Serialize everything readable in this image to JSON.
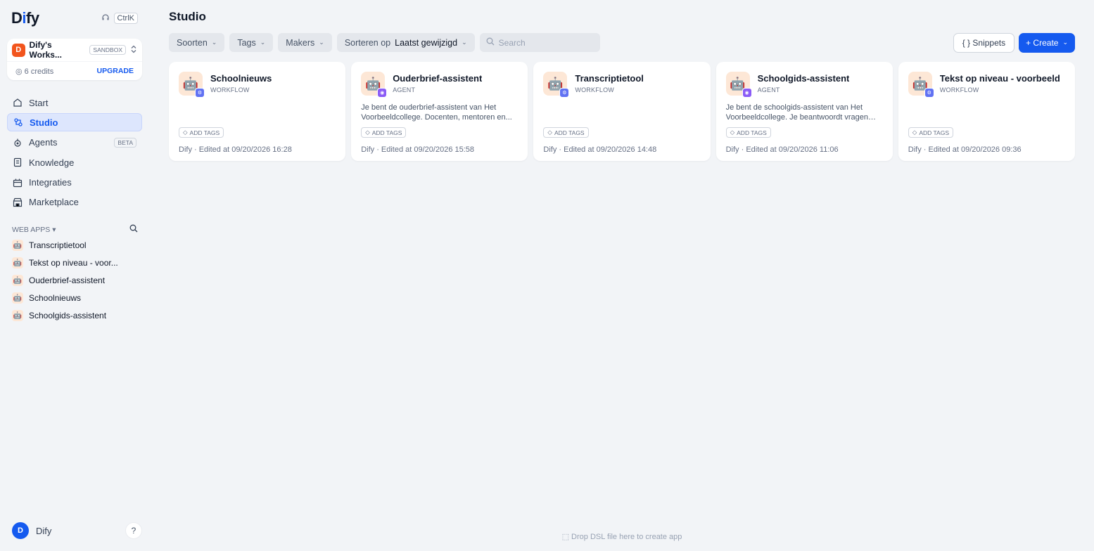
{
  "sidebar": {
    "logo_prefix": "D",
    "logo_i": "i",
    "logo_suffix": "fy",
    "shortcut": "CtrlK",
    "workspace": {
      "avatar": "D",
      "name": "Dify's Works...",
      "plan": "SANDBOX",
      "credits": "6 credits",
      "upgrade": "UPGRADE"
    },
    "nav": [
      {
        "label": "Start",
        "icon": "home-icon"
      },
      {
        "label": "Studio",
        "icon": "studio-icon"
      },
      {
        "label": "Agents",
        "icon": "agents-icon",
        "badge": "BETA"
      },
      {
        "label": "Knowledge",
        "icon": "knowledge-icon"
      },
      {
        "label": "Integraties",
        "icon": "integrations-icon"
      },
      {
        "label": "Marketplace",
        "icon": "marketplace-icon"
      }
    ],
    "webapps_label": "WEB APPS",
    "webapps": [
      "Transcriptietool",
      "Tekst op niveau - voor...",
      "Ouderbrief-assistent",
      "Schoolnieuws",
      "Schoolgids-assistent"
    ],
    "user": {
      "avatar": "D",
      "name": "Dify"
    },
    "help": "?"
  },
  "main": {
    "title": "Studio",
    "filters": {
      "kinds": "Soorten",
      "tags": "Tags",
      "makers": "Makers",
      "sort_prefix": "Sorteren op",
      "sort_value": "Laatst gewijzigd"
    },
    "search": {
      "placeholder": "Search"
    },
    "snippets_label": "{ } Snippets",
    "create_label": "+ Create",
    "add_tags": "ADD TAGS",
    "apps": [
      {
        "name": "Schoolnieuws",
        "type": "WORKFLOW",
        "desc": "",
        "meta": "Dify · Edited at 09/20/2026 16:28"
      },
      {
        "name": "Ouderbrief-assistent",
        "type": "AGENT",
        "desc": "Je bent de ouderbrief-assistent van Het Voorbeeldcollege. Docenten, mentoren en...",
        "meta": "Dify · Edited at 09/20/2026 15:58"
      },
      {
        "name": "Transcriptietool",
        "type": "WORKFLOW",
        "desc": "",
        "meta": "Dify · Edited at 09/20/2026 14:48"
      },
      {
        "name": "Schoolgids-assistent",
        "type": "AGENT",
        "desc": "Je bent de schoolgids-assistent van Het Voorbeeldcollege. Je beantwoordt vragen va...",
        "meta": "Dify · Edited at 09/20/2026 11:06"
      },
      {
        "name": "Tekst op niveau - voorbeeld",
        "type": "WORKFLOW",
        "desc": "",
        "meta": "Dify · Edited at 09/20/2026 09:36"
      }
    ],
    "dropzone": "Drop DSL file here to create app"
  },
  "colors": {
    "accent": "#155aef",
    "workspace": "#f2551d",
    "workflow_badge": "#6172f3",
    "agent_badge": "#8b5cf6"
  }
}
